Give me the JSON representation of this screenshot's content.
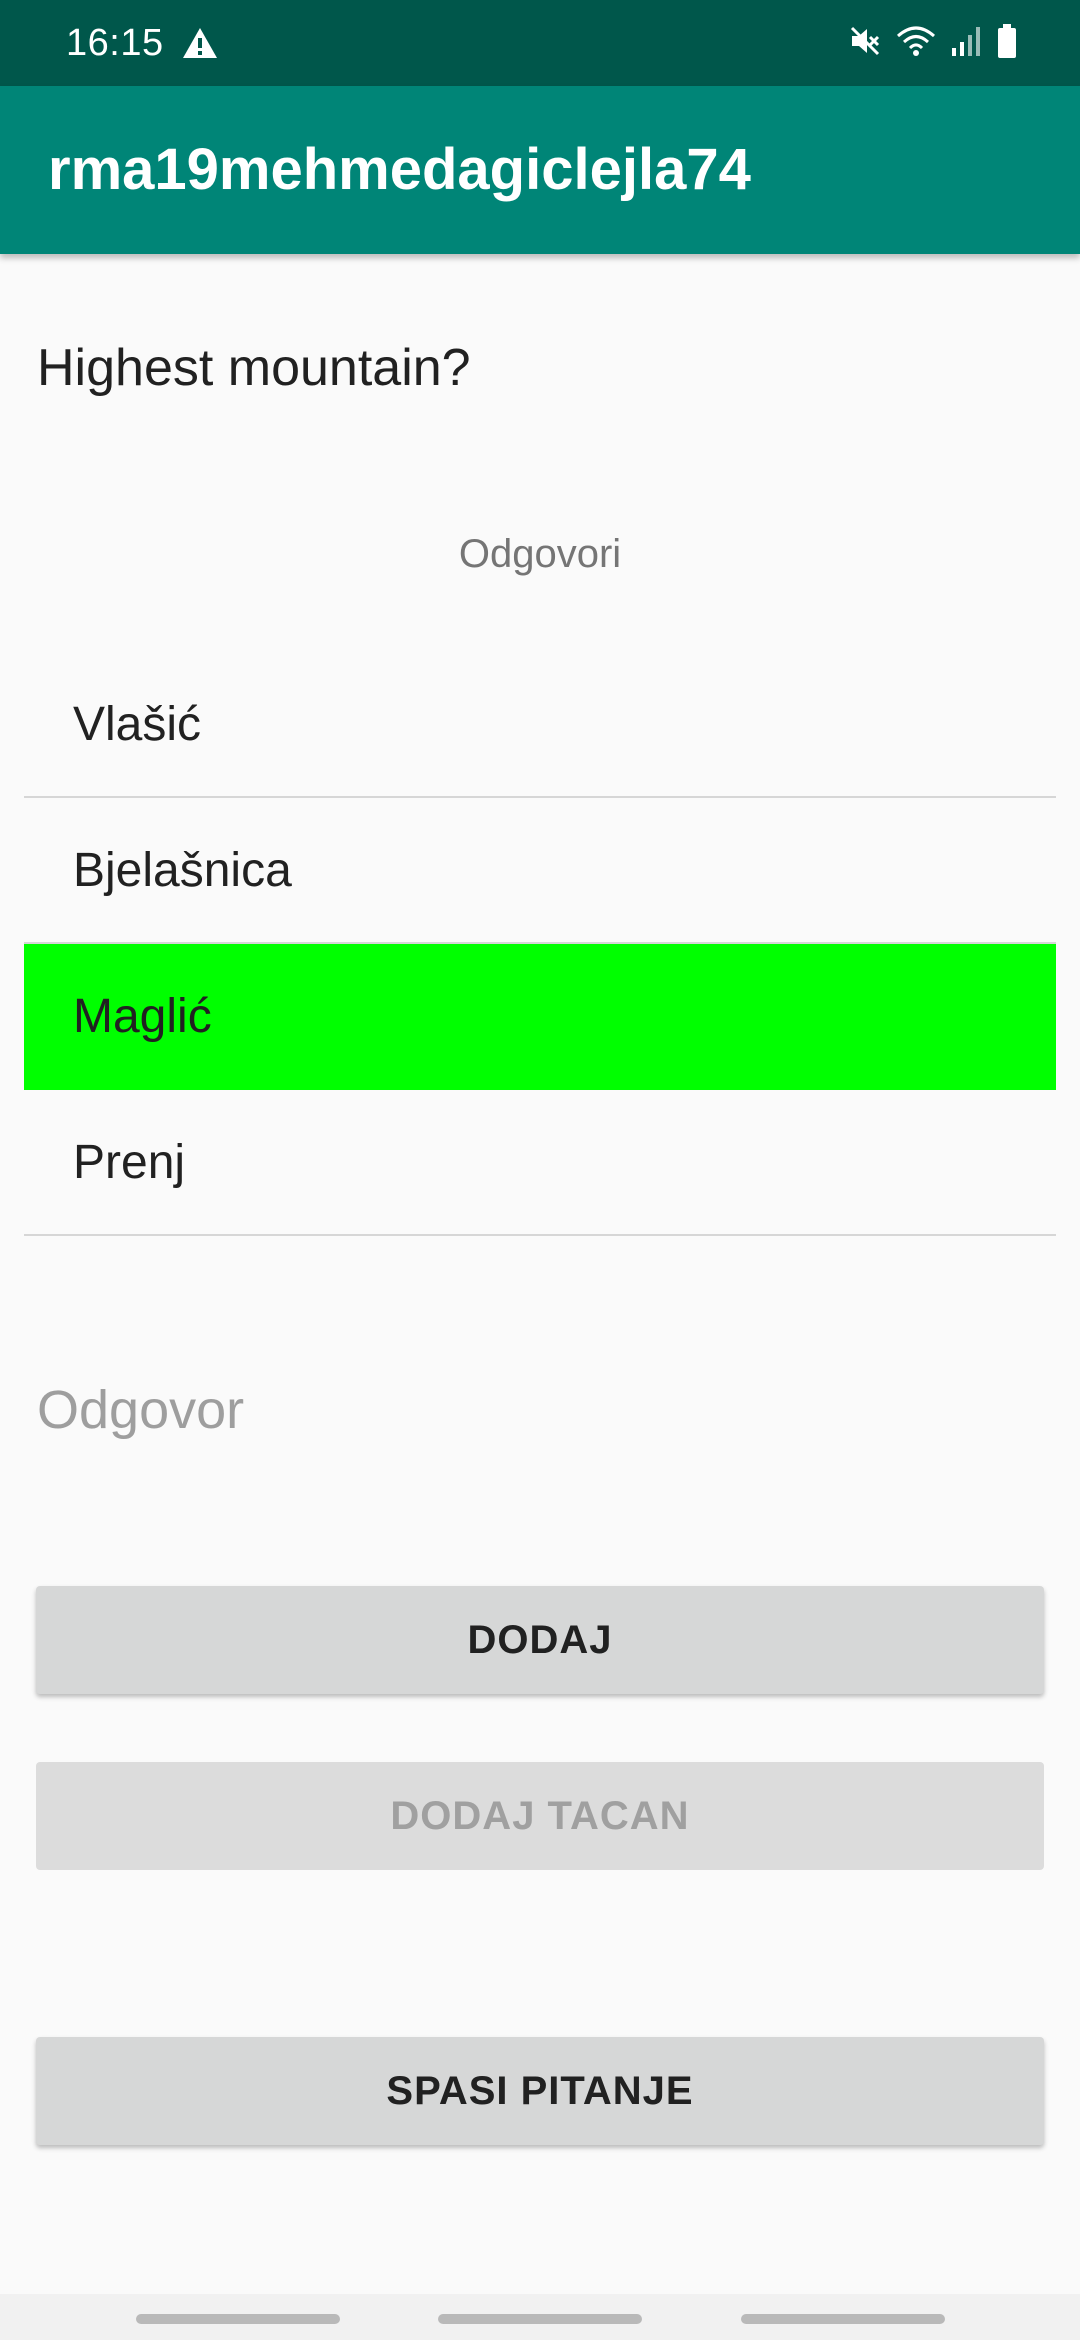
{
  "status_bar": {
    "time": "16:15",
    "left_icons": [
      "warning-icon"
    ],
    "right_icons": [
      "mute-icon",
      "wifi-icon",
      "signal-icon",
      "battery-icon"
    ]
  },
  "app_bar": {
    "title": "rma19mehmedagiclejla74",
    "color": "#008577"
  },
  "question": {
    "text": "Highest mountain?"
  },
  "answers": {
    "heading": "Odgovori",
    "items": [
      {
        "label": "Vlašić",
        "correct": false
      },
      {
        "label": "Bjelašnica",
        "correct": false
      },
      {
        "label": "Maglić",
        "correct": true
      },
      {
        "label": "Prenj",
        "correct": false
      }
    ],
    "correct_color": "#00ff00"
  },
  "answer_input": {
    "value": "",
    "placeholder": "Odgovor"
  },
  "buttons": {
    "add": "DODAJ",
    "add_correct": "DODAJ TACAN",
    "add_correct_enabled": false,
    "save": "SPASI PITANJE"
  }
}
